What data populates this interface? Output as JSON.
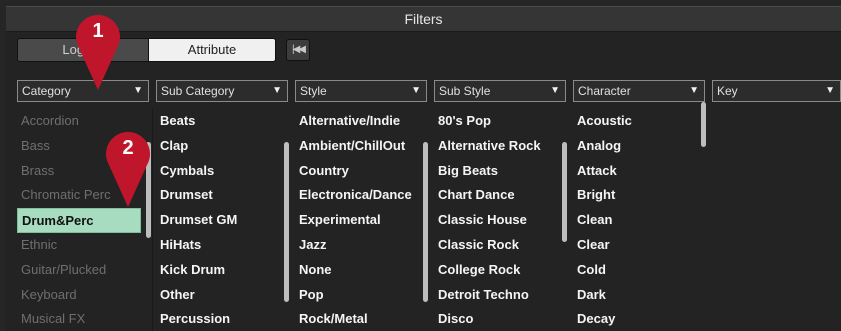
{
  "window": {
    "title": "Filters"
  },
  "toolbar": {
    "logical_label": "Logical",
    "attribute_label": "Attribute",
    "reset_icon": "skip-back-icon"
  },
  "columns": [
    {
      "header": "Category",
      "items": [
        "Accordion",
        "Bass",
        "Brass",
        "Chromatic Perc",
        "Drum&Perc",
        "Ethnic",
        "Guitar/Plucked",
        "Keyboard",
        "Musical FX"
      ],
      "selected": "Drum&Perc"
    },
    {
      "header": "Sub Category",
      "items": [
        "Beats",
        "Clap",
        "Cymbals",
        "Drumset",
        "Drumset GM",
        "HiHats",
        "Kick Drum",
        "Other",
        "Percussion"
      ]
    },
    {
      "header": "Style",
      "items": [
        "Alternative/Indie",
        "Ambient/ChillOut",
        "Country",
        "Electronica/Dance",
        "Experimental",
        "Jazz",
        "None",
        "Pop",
        "Rock/Metal"
      ]
    },
    {
      "header": "Sub Style",
      "items": [
        "80's Pop",
        "Alternative Rock",
        "Big Beats",
        "Chart Dance",
        "Classic House",
        "Classic Rock",
        "College Rock",
        "Detroit Techno",
        "Disco"
      ]
    },
    {
      "header": "Character",
      "items": [
        "Acoustic",
        "Analog",
        "Attack",
        "Bright",
        "Clean",
        "Clear",
        "Cold",
        "Dark",
        "Decay"
      ]
    },
    {
      "header": "Key",
      "items": []
    }
  ],
  "callouts": [
    {
      "number": "1",
      "color": "#c0162c"
    },
    {
      "number": "2",
      "color": "#c0162c"
    }
  ]
}
